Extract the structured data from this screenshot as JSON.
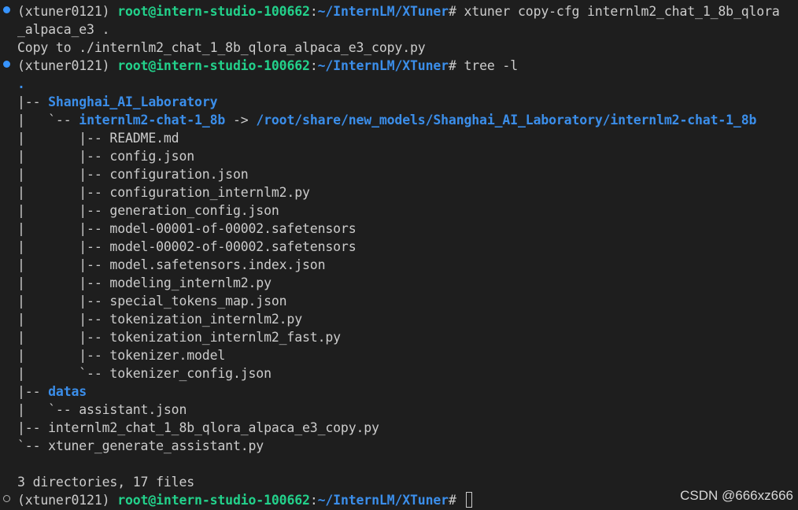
{
  "prompt": {
    "env": "(xtuner0121) ",
    "userhost": "root@intern-studio-100662",
    "colon": ":",
    "path": "~/InternLM/XTuner",
    "dollar": "# "
  },
  "commands": {
    "copy_cfg_part1": "xtuner copy-cfg internlm2_chat_1_8b_qlora",
    "copy_cfg_part2": "_alpaca_e3 .",
    "copy_output": "Copy to ./internlm2_chat_1_8b_qlora_alpaca_e3_copy.py",
    "tree": "tree -l"
  },
  "tree": {
    "root": ".",
    "dir1_prefix": "|-- ",
    "dir1": "Shanghai_AI_Laboratory",
    "link_prefix": "|   `-- ",
    "link_name": "internlm2-chat-1_8b",
    "link_arrow": " -> ",
    "link_target": "/root/share/new_models/Shanghai_AI_Laboratory/internlm2-chat-1_8b",
    "model_files": [
      "|       |-- README.md",
      "|       |-- config.json",
      "|       |-- configuration.json",
      "|       |-- configuration_internlm2.py",
      "|       |-- generation_config.json",
      "|       |-- model-00001-of-00002.safetensors",
      "|       |-- model-00002-of-00002.safetensors",
      "|       |-- model.safetensors.index.json",
      "|       |-- modeling_internlm2.py",
      "|       |-- special_tokens_map.json",
      "|       |-- tokenization_internlm2.py",
      "|       |-- tokenization_internlm2_fast.py",
      "|       |-- tokenizer.model",
      "|       `-- tokenizer_config.json"
    ],
    "dir2_prefix": "|-- ",
    "dir2": "datas",
    "dir2_file": "|   `-- assistant.json",
    "file1": "|-- internlm2_chat_1_8b_qlora_alpaca_e3_copy.py",
    "file2": "`-- xtuner_generate_assistant.py",
    "summary": "3 directories, 17 files"
  },
  "watermark": "CSDN @666xz666",
  "colors": {
    "background": "#1e1e1e",
    "text": "#cccccc",
    "prompt_green": "#23d18b",
    "path_blue": "#3b8eea",
    "status_dot": "#3794ff"
  }
}
